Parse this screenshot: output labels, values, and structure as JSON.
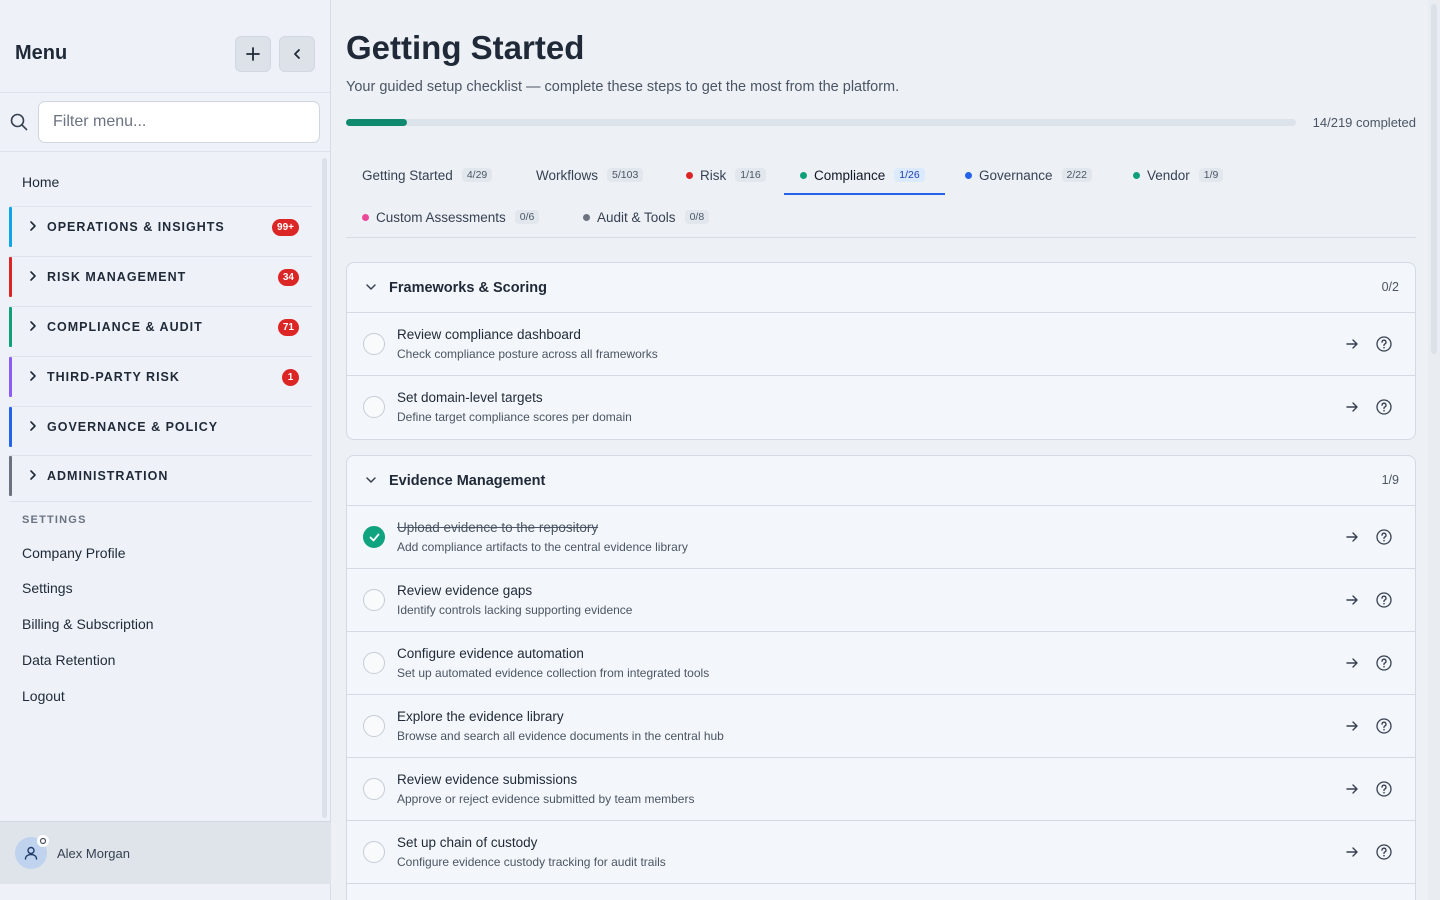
{
  "sidebar": {
    "title": "Menu",
    "filter_placeholder": "Filter menu...",
    "home_label": "Home",
    "sections": [
      {
        "label": "OPERATIONS & INSIGHTS",
        "badge": "99+",
        "color": "#0ea5e9"
      },
      {
        "label": "RISK MANAGEMENT",
        "badge": "34",
        "color": "#dc2626"
      },
      {
        "label": "COMPLIANCE & AUDIT",
        "badge": "71",
        "color": "#0f9f7a"
      },
      {
        "label": "THIRD-PARTY RISK",
        "badge": "1",
        "color": "#8b5cf6"
      },
      {
        "label": "GOVERNANCE & POLICY",
        "badge": "",
        "color": "#2563eb"
      },
      {
        "label": "ADMINISTRATION",
        "badge": "",
        "color": "#6b7280"
      }
    ],
    "settings_heading": "SETTINGS",
    "settings_items": [
      "Company Profile",
      "Settings",
      "Billing & Subscription",
      "Data Retention",
      "Logout"
    ],
    "user_name": "Alex Morgan"
  },
  "main": {
    "title": "Getting Started",
    "subtitle": "Your guided setup checklist — complete these steps to get the most from the platform.",
    "progress_text": "14/219 completed",
    "progress_fraction": 0.0639,
    "tabs": [
      {
        "label": "Getting Started",
        "count": "4/29",
        "dot": ""
      },
      {
        "label": "Workflows",
        "count": "5/103",
        "dot": ""
      },
      {
        "label": "Risk",
        "count": "1/16",
        "dot": "#dc2626"
      },
      {
        "label": "Compliance",
        "count": "1/26",
        "dot": "#0f9f7a",
        "active": true
      },
      {
        "label": "Governance",
        "count": "2/22",
        "dot": "#2563eb"
      },
      {
        "label": "Vendor",
        "count": "1/9",
        "dot": "#0f9f7a"
      },
      {
        "label": "Custom Assessments",
        "count": "0/6",
        "dot": "#ec4899"
      },
      {
        "label": "Audit & Tools",
        "count": "0/8",
        "dot": "#6b7280"
      }
    ],
    "groups": [
      {
        "title": "Frameworks & Scoring",
        "count": "0/2",
        "items": [
          {
            "title": "Review compliance dashboard",
            "desc": "Check compliance posture across all frameworks",
            "done": false
          },
          {
            "title": "Set domain-level targets",
            "desc": "Define target compliance scores per domain",
            "done": false
          }
        ]
      },
      {
        "title": "Evidence Management",
        "count": "1/9",
        "items": [
          {
            "title": "Upload evidence to the repository",
            "desc": "Add compliance artifacts to the central evidence library",
            "done": true
          },
          {
            "title": "Review evidence gaps",
            "desc": "Identify controls lacking supporting evidence",
            "done": false
          },
          {
            "title": "Configure evidence automation",
            "desc": "Set up automated evidence collection from integrated tools",
            "done": false
          },
          {
            "title": "Explore the evidence library",
            "desc": "Browse and search all evidence documents in the central hub",
            "done": false
          },
          {
            "title": "Review evidence submissions",
            "desc": "Approve or reject evidence submitted by team members",
            "done": false
          },
          {
            "title": "Set up chain of custody",
            "desc": "Configure evidence custody tracking for audit trails",
            "done": false
          }
        ]
      }
    ]
  },
  "colors": {
    "accent": "#2563eb",
    "progress": "#0f8a6e",
    "done": "#10a37f",
    "badge": "#dc2626"
  }
}
